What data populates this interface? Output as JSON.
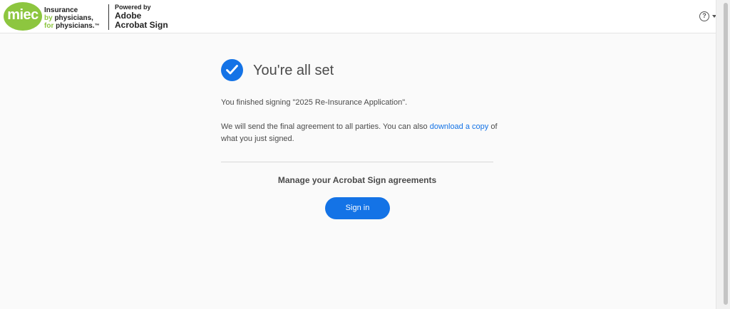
{
  "header": {
    "logo_text": "miec",
    "tagline": {
      "line1": "Insurance",
      "line2_prefix": "by ",
      "line2_rest": "physicians,",
      "line3_prefix": "for ",
      "line3_rest": "physicians.",
      "line3_mark": "™"
    },
    "powered_by": "Powered by",
    "adobe_line1": "Adobe",
    "adobe_line2": "Acrobat Sign",
    "help_symbol": "?"
  },
  "main": {
    "title": "You're all set",
    "finished_text": "You finished signing \"2025 Re-Insurance Application\".",
    "send_text_before": "We will send the final agreement to all parties. You can also ",
    "download_link": "download a copy",
    "send_text_after": " of what you just signed.",
    "manage_heading": "Manage your Acrobat Sign agreements",
    "signin_label": "Sign in"
  },
  "colors": {
    "accent": "#1473e6",
    "brand_green": "#8dc63f"
  },
  "icons": {
    "status": "checkmark-circle-icon",
    "help": "help-circle-icon",
    "dropdown": "caret-down-icon"
  }
}
